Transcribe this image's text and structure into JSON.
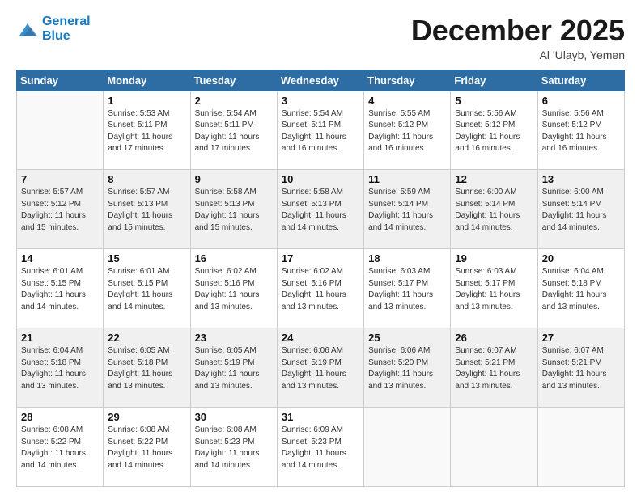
{
  "logo": {
    "line1": "General",
    "line2": "Blue"
  },
  "title": "December 2025",
  "location": "Al 'Ulayb, Yemen",
  "weekdays": [
    "Sunday",
    "Monday",
    "Tuesday",
    "Wednesday",
    "Thursday",
    "Friday",
    "Saturday"
  ],
  "weeks": [
    [
      {
        "day": "",
        "info": ""
      },
      {
        "day": "1",
        "info": "Sunrise: 5:53 AM\nSunset: 5:11 PM\nDaylight: 11 hours\nand 17 minutes."
      },
      {
        "day": "2",
        "info": "Sunrise: 5:54 AM\nSunset: 5:11 PM\nDaylight: 11 hours\nand 17 minutes."
      },
      {
        "day": "3",
        "info": "Sunrise: 5:54 AM\nSunset: 5:11 PM\nDaylight: 11 hours\nand 16 minutes."
      },
      {
        "day": "4",
        "info": "Sunrise: 5:55 AM\nSunset: 5:12 PM\nDaylight: 11 hours\nand 16 minutes."
      },
      {
        "day": "5",
        "info": "Sunrise: 5:56 AM\nSunset: 5:12 PM\nDaylight: 11 hours\nand 16 minutes."
      },
      {
        "day": "6",
        "info": "Sunrise: 5:56 AM\nSunset: 5:12 PM\nDaylight: 11 hours\nand 16 minutes."
      }
    ],
    [
      {
        "day": "7",
        "info": "Sunrise: 5:57 AM\nSunset: 5:12 PM\nDaylight: 11 hours\nand 15 minutes."
      },
      {
        "day": "8",
        "info": "Sunrise: 5:57 AM\nSunset: 5:13 PM\nDaylight: 11 hours\nand 15 minutes."
      },
      {
        "day": "9",
        "info": "Sunrise: 5:58 AM\nSunset: 5:13 PM\nDaylight: 11 hours\nand 15 minutes."
      },
      {
        "day": "10",
        "info": "Sunrise: 5:58 AM\nSunset: 5:13 PM\nDaylight: 11 hours\nand 14 minutes."
      },
      {
        "day": "11",
        "info": "Sunrise: 5:59 AM\nSunset: 5:14 PM\nDaylight: 11 hours\nand 14 minutes."
      },
      {
        "day": "12",
        "info": "Sunrise: 6:00 AM\nSunset: 5:14 PM\nDaylight: 11 hours\nand 14 minutes."
      },
      {
        "day": "13",
        "info": "Sunrise: 6:00 AM\nSunset: 5:14 PM\nDaylight: 11 hours\nand 14 minutes."
      }
    ],
    [
      {
        "day": "14",
        "info": "Sunrise: 6:01 AM\nSunset: 5:15 PM\nDaylight: 11 hours\nand 14 minutes."
      },
      {
        "day": "15",
        "info": "Sunrise: 6:01 AM\nSunset: 5:15 PM\nDaylight: 11 hours\nand 14 minutes."
      },
      {
        "day": "16",
        "info": "Sunrise: 6:02 AM\nSunset: 5:16 PM\nDaylight: 11 hours\nand 13 minutes."
      },
      {
        "day": "17",
        "info": "Sunrise: 6:02 AM\nSunset: 5:16 PM\nDaylight: 11 hours\nand 13 minutes."
      },
      {
        "day": "18",
        "info": "Sunrise: 6:03 AM\nSunset: 5:17 PM\nDaylight: 11 hours\nand 13 minutes."
      },
      {
        "day": "19",
        "info": "Sunrise: 6:03 AM\nSunset: 5:17 PM\nDaylight: 11 hours\nand 13 minutes."
      },
      {
        "day": "20",
        "info": "Sunrise: 6:04 AM\nSunset: 5:18 PM\nDaylight: 11 hours\nand 13 minutes."
      }
    ],
    [
      {
        "day": "21",
        "info": "Sunrise: 6:04 AM\nSunset: 5:18 PM\nDaylight: 11 hours\nand 13 minutes."
      },
      {
        "day": "22",
        "info": "Sunrise: 6:05 AM\nSunset: 5:18 PM\nDaylight: 11 hours\nand 13 minutes."
      },
      {
        "day": "23",
        "info": "Sunrise: 6:05 AM\nSunset: 5:19 PM\nDaylight: 11 hours\nand 13 minutes."
      },
      {
        "day": "24",
        "info": "Sunrise: 6:06 AM\nSunset: 5:19 PM\nDaylight: 11 hours\nand 13 minutes."
      },
      {
        "day": "25",
        "info": "Sunrise: 6:06 AM\nSunset: 5:20 PM\nDaylight: 11 hours\nand 13 minutes."
      },
      {
        "day": "26",
        "info": "Sunrise: 6:07 AM\nSunset: 5:21 PM\nDaylight: 11 hours\nand 13 minutes."
      },
      {
        "day": "27",
        "info": "Sunrise: 6:07 AM\nSunset: 5:21 PM\nDaylight: 11 hours\nand 13 minutes."
      }
    ],
    [
      {
        "day": "28",
        "info": "Sunrise: 6:08 AM\nSunset: 5:22 PM\nDaylight: 11 hours\nand 14 minutes."
      },
      {
        "day": "29",
        "info": "Sunrise: 6:08 AM\nSunset: 5:22 PM\nDaylight: 11 hours\nand 14 minutes."
      },
      {
        "day": "30",
        "info": "Sunrise: 6:08 AM\nSunset: 5:23 PM\nDaylight: 11 hours\nand 14 minutes."
      },
      {
        "day": "31",
        "info": "Sunrise: 6:09 AM\nSunset: 5:23 PM\nDaylight: 11 hours\nand 14 minutes."
      },
      {
        "day": "",
        "info": ""
      },
      {
        "day": "",
        "info": ""
      },
      {
        "day": "",
        "info": ""
      }
    ]
  ]
}
